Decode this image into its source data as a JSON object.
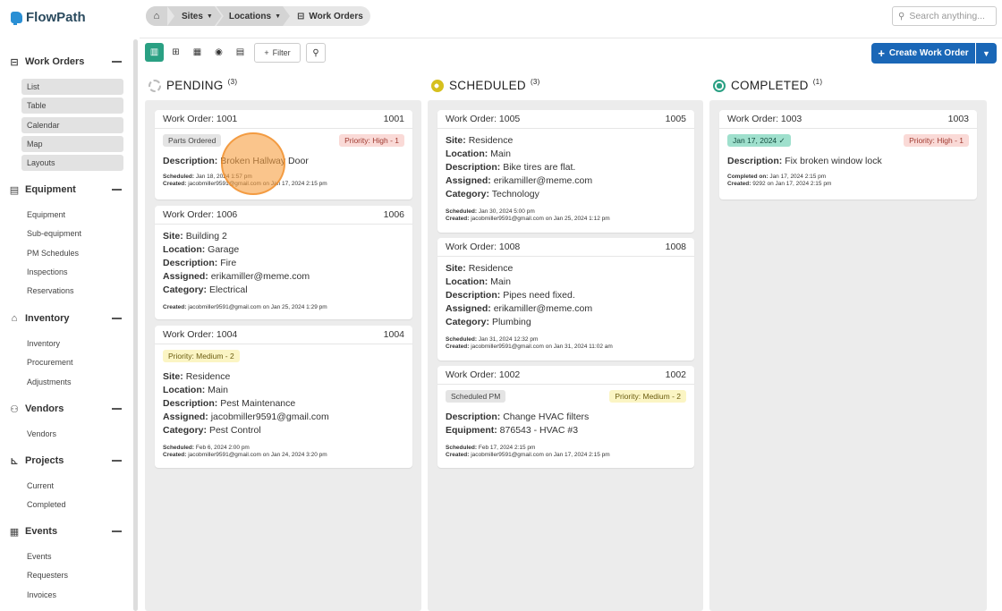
{
  "app": {
    "name": "FlowPath"
  },
  "sidebar": {
    "sections": [
      {
        "label": "Work Orders",
        "icon": "tray-icon",
        "items": [
          "List",
          "Table",
          "Calendar",
          "Map",
          "Layouts"
        ]
      },
      {
        "label": "Equipment",
        "icon": "toolbox-icon",
        "items": [
          "Equipment",
          "Sub-equipment",
          "PM Schedules",
          "Inspections",
          "Reservations"
        ]
      },
      {
        "label": "Inventory",
        "icon": "warehouse-icon",
        "items": [
          "Inventory",
          "Procurement",
          "Adjustments"
        ]
      },
      {
        "label": "Vendors",
        "icon": "people-icon",
        "items": [
          "Vendors"
        ]
      },
      {
        "label": "Projects",
        "icon": "chart-icon",
        "items": [
          "Current",
          "Completed"
        ]
      },
      {
        "label": "Events",
        "icon": "calendar-icon",
        "items": [
          "Events",
          "Requesters",
          "Invoices"
        ]
      }
    ]
  },
  "breadcrumb": {
    "home": "home-icon",
    "sites": "Sites",
    "locations": "Locations",
    "current": "Work Orders"
  },
  "search": {
    "placeholder": "Search anything..."
  },
  "toolbar": {
    "filter_label": "Filter",
    "create_label": "Create Work Order"
  },
  "colors": {
    "accent": "#2aa083",
    "primary": "#1a67b7",
    "priority_high": "#fadad7",
    "priority_medium": "#fbf5c4"
  },
  "columns": {
    "pending": {
      "title": "PENDING",
      "count": "(3)",
      "cards": [
        {
          "title": "Work Order: 1001",
          "id": "1001",
          "tag_left": "Parts Ordered",
          "tag_right": "Priority: High - 1",
          "description": "Broken Hallway Door",
          "scheduled": "Jan 18, 2024 1:57 pm",
          "created": "jacobmiller9591@gmail.com on Jan 17, 2024 2:15 pm"
        },
        {
          "title": "Work Order: 1006",
          "id": "1006",
          "site": "Building 2",
          "location": "Garage",
          "description": "Fire",
          "assigned": "erikamiller@meme.com",
          "category": "Electrical",
          "created": "jacobmiller9591@gmail.com on Jan 25, 2024 1:29 pm"
        },
        {
          "title": "Work Order: 1004",
          "id": "1004",
          "tag_left": "Priority: Medium - 2",
          "site": "Residence",
          "location": "Main",
          "description": "Pest Maintenance",
          "assigned": "jacobmiller9591@gmail.com",
          "category": "Pest Control",
          "scheduled": "Feb 6, 2024 2:00 pm",
          "created": "jacobmiller9591@gmail.com on Jan 24, 2024 3:20 pm"
        }
      ]
    },
    "scheduled": {
      "title": "SCHEDULED",
      "count": "(3)",
      "cards": [
        {
          "title": "Work Order: 1005",
          "id": "1005",
          "site": "Residence",
          "location": "Main",
          "description": "Bike tires are flat.",
          "assigned": "erikamiller@meme.com",
          "category": "Technology",
          "scheduled": "Jan 30, 2024 5:00 pm",
          "created": "jacobmiller9591@gmail.com on Jan 25, 2024 1:12 pm"
        },
        {
          "title": "Work Order: 1008",
          "id": "1008",
          "site": "Residence",
          "location": "Main",
          "description": "Pipes need fixed.",
          "assigned": "erikamiller@meme.com",
          "category": "Plumbing",
          "scheduled": "Jan 31, 2024 12:32 pm",
          "created": "jacobmiller9591@gmail.com on Jan 31, 2024 11:02 am"
        },
        {
          "title": "Work Order: 1002",
          "id": "1002",
          "tag_left": "Scheduled PM",
          "tag_right": "Priority: Medium - 2",
          "description": "Change HVAC filters",
          "equipment": "876543 - HVAC #3",
          "scheduled": "Feb 17, 2024 2:15 pm",
          "created": "jacobmiller9591@gmail.com on Jan 17, 2024 2:15 pm"
        }
      ]
    },
    "completed": {
      "title": "COMPLETED",
      "count": "(1)",
      "cards": [
        {
          "title": "Work Order: 1003",
          "id": "1003",
          "tag_left": "Jan 17, 2024 ✓",
          "tag_right": "Priority: High - 1",
          "description": "Fix broken window lock",
          "completed_on": "Jan 17, 2024 2:15 pm",
          "created": "9292 on Jan 17, 2024 2:15 pm"
        }
      ]
    }
  },
  "labels": {
    "site": "Site:",
    "location": "Location:",
    "description": "Description:",
    "assigned": "Assigned:",
    "category": "Category:",
    "equipment": "Equipment:",
    "scheduled": "Scheduled:",
    "created": "Created:",
    "completed_on": "Completed on:"
  }
}
